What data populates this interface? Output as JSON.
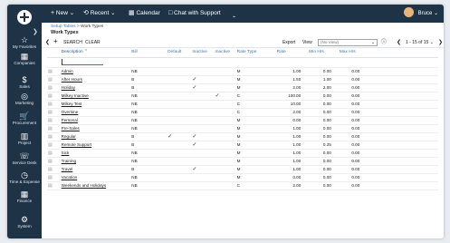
{
  "app": {
    "accent": "#1f3347",
    "link_color": "#3a78b5"
  },
  "sidebar": {
    "collapse_icon": "chevron-right-icon",
    "items": [
      {
        "label": "My Favorites",
        "icon": "star-icon"
      },
      {
        "label": "Companies",
        "icon": "building-icon"
      },
      {
        "label": "Sales",
        "icon": "dollar-icon"
      },
      {
        "label": "Marketing",
        "icon": "target-icon"
      },
      {
        "label": "Procurement",
        "icon": "cart-icon"
      },
      {
        "label": "Project",
        "icon": "chart-icon"
      },
      {
        "label": "Service Desk",
        "icon": "headset-icon"
      },
      {
        "label": "Time & Expense",
        "icon": "clock-icon"
      },
      {
        "label": "Finance",
        "icon": "grid-icon"
      },
      {
        "label": "System",
        "icon": "gear-icon"
      }
    ]
  },
  "topbar": {
    "new_label": "New",
    "recent_label": "Recent",
    "calendar_label": "Calendar",
    "chat_label": "Chat with Support",
    "user_name": "Bruce"
  },
  "breadcrumb": {
    "parent": "Setup Tables",
    "current": "Work Types"
  },
  "page_title": "Work Types",
  "toolbar": {
    "search_label": "SEARCH",
    "clear_label": "CLEAR",
    "export_label": "Export",
    "view_label": "View",
    "view_value": "(No View)",
    "paging": "1 - 15 of 15"
  },
  "table": {
    "columns": [
      "Description",
      "Bill",
      "Default",
      "Inactive",
      "Inactive",
      "Rate Type",
      "Rate",
      "Min Hrs",
      "Max Hrs"
    ],
    "rows": [
      {
        "description": "Admin",
        "bill": "NB",
        "default": false,
        "c3": false,
        "c4": false,
        "rate_type": "M",
        "rate": "1.00",
        "min": "0.00",
        "max": "0.00"
      },
      {
        "description": "After Hours",
        "bill": "B",
        "default": false,
        "c3": true,
        "c4": false,
        "rate_type": "M",
        "rate": "1.50",
        "min": "1.00",
        "max": "0.00"
      },
      {
        "description": "Holiday",
        "bill": "B",
        "default": false,
        "c3": true,
        "c4": false,
        "rate_type": "M",
        "rate": "2.00",
        "min": "2.00",
        "max": "0.00"
      },
      {
        "description": "Milkey Inactive",
        "bill": "NB",
        "default": false,
        "c3": false,
        "c4": true,
        "rate_type": "C",
        "rate": "100.00",
        "min": "0.00",
        "max": "0.00"
      },
      {
        "description": "Milkey Test",
        "bill": "NB",
        "default": false,
        "c3": false,
        "c4": false,
        "rate_type": "C",
        "rate": "10.00",
        "min": "0.00",
        "max": "0.00"
      },
      {
        "description": "Overtime",
        "bill": "NB",
        "default": false,
        "c3": false,
        "c4": false,
        "rate_type": "C",
        "rate": "2.00",
        "min": "0.00",
        "max": "0.00"
      },
      {
        "description": "Personal",
        "bill": "NB",
        "default": false,
        "c3": false,
        "c4": false,
        "rate_type": "M",
        "rate": "0.00",
        "min": "0.00",
        "max": "0.00"
      },
      {
        "description": "Pre-Sales",
        "bill": "NB",
        "default": false,
        "c3": false,
        "c4": false,
        "rate_type": "M",
        "rate": "1.00",
        "min": "0.00",
        "max": "0.00"
      },
      {
        "description": "Regular",
        "bill": "B",
        "default": true,
        "c3": true,
        "c4": false,
        "rate_type": "M",
        "rate": "1.00",
        "min": "0.00",
        "max": "0.00"
      },
      {
        "description": "Remote Support",
        "bill": "B",
        "default": false,
        "c3": true,
        "c4": false,
        "rate_type": "M",
        "rate": "1.00",
        "min": "0.25",
        "max": "0.00"
      },
      {
        "description": "Sick",
        "bill": "NB",
        "default": false,
        "c3": false,
        "c4": false,
        "rate_type": "M",
        "rate": "1.00",
        "min": "0.00",
        "max": "0.00"
      },
      {
        "description": "Training",
        "bill": "NB",
        "default": false,
        "c3": false,
        "c4": false,
        "rate_type": "M",
        "rate": "1.00",
        "min": "0.00",
        "max": "0.00"
      },
      {
        "description": "Travel",
        "bill": "B",
        "default": false,
        "c3": true,
        "c4": false,
        "rate_type": "M",
        "rate": "1.00",
        "min": "0.00",
        "max": "0.00"
      },
      {
        "description": "Vacation",
        "bill": "NB",
        "default": false,
        "c3": false,
        "c4": false,
        "rate_type": "M",
        "rate": "0.00",
        "min": "0.00",
        "max": "0.00"
      },
      {
        "description": "Weekends and Holidays",
        "bill": "NB",
        "default": false,
        "c3": false,
        "c4": false,
        "rate_type": "C",
        "rate": "2.00",
        "min": "0.00",
        "max": "0.00"
      }
    ]
  }
}
